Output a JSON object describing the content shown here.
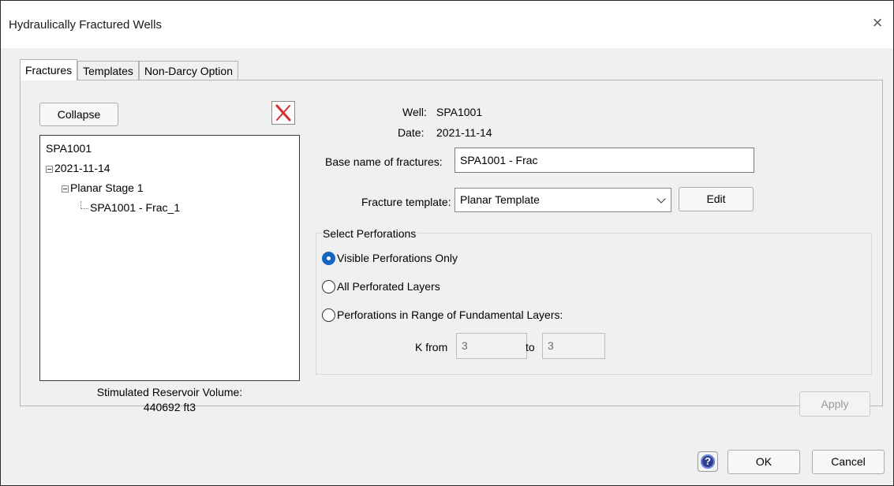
{
  "window": {
    "title": "Hydraulically Fractured Wells",
    "close_glyph": "×"
  },
  "tabs": [
    {
      "label": "Fractures",
      "active": true
    },
    {
      "label": "Templates",
      "active": false
    },
    {
      "label": "Non-Darcy Option",
      "active": false
    }
  ],
  "left": {
    "collapse_label": "Collapse",
    "tree": {
      "root": "SPA1001",
      "date": "2021-11-14",
      "stage": "Planar Stage 1",
      "fracture": "SPA1001 - Frac_1"
    },
    "srv_label": "Stimulated Reservoir Volume:",
    "srv_value": "440692 ft3"
  },
  "details": {
    "well_label": "Well:",
    "well_value": "SPA1001",
    "date_label": "Date:",
    "date_value": "2021-11-14",
    "base_name_label": "Base name of fractures:",
    "base_name_value": "SPA1001 - Frac",
    "template_label": "Fracture template:",
    "template_value": "Planar Template",
    "edit_label": "Edit"
  },
  "perforations": {
    "group_label": "Select Perforations",
    "options": [
      {
        "label": "Visible Perforations Only",
        "selected": true
      },
      {
        "label": "All Perforated Layers",
        "selected": false
      },
      {
        "label": "Perforations in Range of Fundamental Layers:",
        "selected": false
      }
    ],
    "k_from_label": "K from",
    "k_from_value": "3",
    "to_label": "to",
    "to_value": "3"
  },
  "apply_label": "Apply",
  "footer": {
    "ok_label": "OK",
    "cancel_label": "Cancel",
    "help_glyph": "?"
  },
  "colors": {
    "radio_accent": "#1565c0",
    "delete_icon": "#d32f2f",
    "help_icon": "#2c3d8f"
  },
  "icons": {
    "delete": "red-x-delete-icon",
    "help": "question-circle-icon",
    "close": "close-icon",
    "dropdown": "chevron-down-icon"
  }
}
